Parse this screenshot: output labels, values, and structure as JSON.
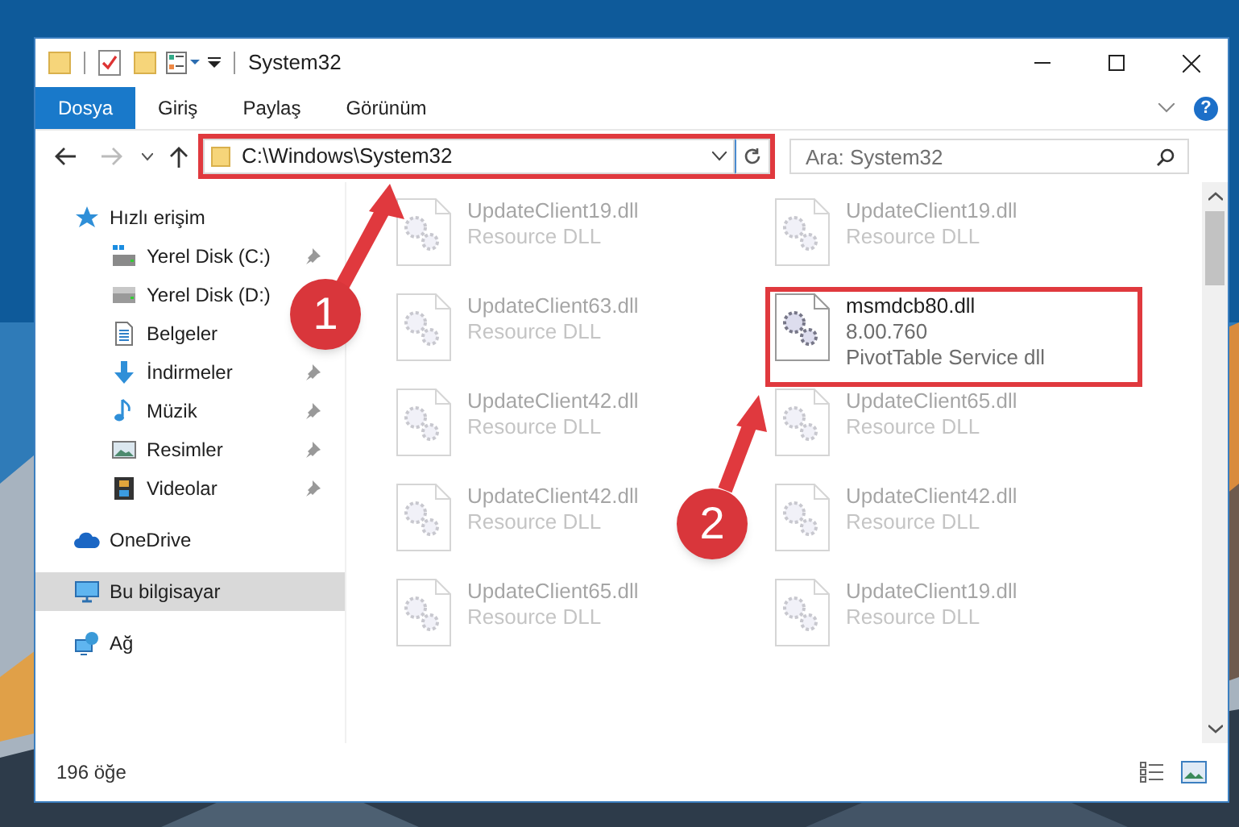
{
  "window": {
    "title": "System32",
    "help": "?"
  },
  "ribbon_tabs": [
    {
      "label": "Dosya",
      "selected": true
    },
    {
      "label": "Giriş",
      "selected": false
    },
    {
      "label": "Paylaş",
      "selected": false
    },
    {
      "label": "Görünüm",
      "selected": false
    }
  ],
  "address": {
    "path": "C:\\Windows\\System32"
  },
  "search": {
    "placeholder": "Ara: System32"
  },
  "sidebar": [
    {
      "label": "Hızlı erişim",
      "kind": "star",
      "selected": false,
      "children": [
        {
          "label": "Yerel Disk (C:)",
          "kind": "system-drive",
          "pinned": true
        },
        {
          "label": "Yerel Disk (D:)",
          "kind": "drive",
          "pinned": false
        },
        {
          "label": "Belgeler",
          "kind": "documents",
          "pinned": false
        },
        {
          "label": "İndirmeler",
          "kind": "downloads",
          "pinned": true
        },
        {
          "label": "Müzik",
          "kind": "music",
          "pinned": true
        },
        {
          "label": "Resimler",
          "kind": "pictures",
          "pinned": true
        },
        {
          "label": "Videolar",
          "kind": "videos",
          "pinned": true
        }
      ]
    },
    {
      "label": "OneDrive",
      "kind": "cloud",
      "selected": false
    },
    {
      "label": "Bu bilgisayar",
      "kind": "computer",
      "selected": true
    },
    {
      "label": "Ağ",
      "kind": "network",
      "selected": false
    }
  ],
  "files": [
    {
      "lines": [
        "UpdateClient19.dll",
        "Resource DLL"
      ],
      "faded": true,
      "highlighted": false
    },
    {
      "lines": [
        "UpdateClient19.dll",
        "Resource DLL"
      ],
      "faded": true,
      "highlighted": false
    },
    {
      "lines": [
        "UpdateClient63.dll",
        "Resource DLL"
      ],
      "faded": true,
      "highlighted": false
    },
    {
      "lines": [
        "msmdcb80.dll",
        "8.00.760",
        "PivotTable Service dll"
      ],
      "faded": false,
      "highlighted": true
    },
    {
      "lines": [
        "UpdateClient42.dll",
        "Resource DLL"
      ],
      "faded": true,
      "highlighted": false
    },
    {
      "lines": [
        "UpdateClient65.dll",
        "Resource DLL"
      ],
      "faded": true,
      "highlighted": false
    },
    {
      "lines": [
        "UpdateClient42.dll",
        "Resource DLL"
      ],
      "faded": true,
      "highlighted": false
    },
    {
      "lines": [
        "UpdateClient42.dll",
        "Resource DLL"
      ],
      "faded": true,
      "highlighted": false
    },
    {
      "lines": [
        "UpdateClient65.dll",
        "Resource DLL"
      ],
      "faded": true,
      "highlighted": false
    },
    {
      "lines": [
        "UpdateClient19.dll",
        "Resource DLL"
      ],
      "faded": true,
      "highlighted": false
    }
  ],
  "status_bar": {
    "count": "196 öğe"
  },
  "annotations": [
    {
      "number": "1"
    },
    {
      "number": "2"
    }
  ]
}
